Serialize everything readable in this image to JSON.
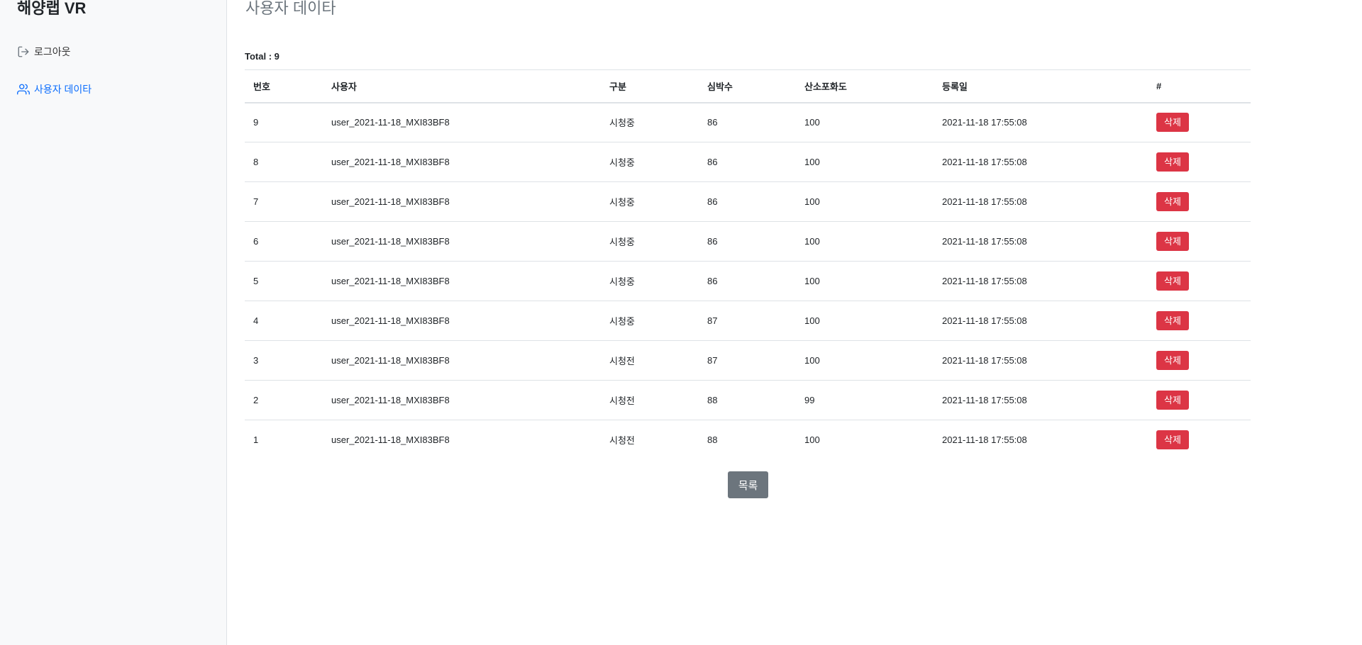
{
  "sidebar": {
    "brand": "해양랩 VR",
    "items": [
      {
        "label": "로그아웃",
        "icon": "logout-icon"
      },
      {
        "label": "사용자 데이타",
        "icon": "users-icon",
        "active": true
      }
    ]
  },
  "main": {
    "title": "사용자 데이타",
    "total": "Total : 9",
    "columns": [
      "번호",
      "사용자",
      "구분",
      "심박수",
      "산소포화도",
      "등록일",
      "#"
    ],
    "rows": [
      {
        "no": "9",
        "user": "user_2021-11-18_MXI83BF8",
        "type": "시청중",
        "hr": "86",
        "spo2": "100",
        "date": "2021-11-18 17:55:08",
        "action": "삭제"
      },
      {
        "no": "8",
        "user": "user_2021-11-18_MXI83BF8",
        "type": "시청중",
        "hr": "86",
        "spo2": "100",
        "date": "2021-11-18 17:55:08",
        "action": "삭제"
      },
      {
        "no": "7",
        "user": "user_2021-11-18_MXI83BF8",
        "type": "시청중",
        "hr": "86",
        "spo2": "100",
        "date": "2021-11-18 17:55:08",
        "action": "삭제"
      },
      {
        "no": "6",
        "user": "user_2021-11-18_MXI83BF8",
        "type": "시청중",
        "hr": "86",
        "spo2": "100",
        "date": "2021-11-18 17:55:08",
        "action": "삭제"
      },
      {
        "no": "5",
        "user": "user_2021-11-18_MXI83BF8",
        "type": "시청중",
        "hr": "86",
        "spo2": "100",
        "date": "2021-11-18 17:55:08",
        "action": "삭제"
      },
      {
        "no": "4",
        "user": "user_2021-11-18_MXI83BF8",
        "type": "시청중",
        "hr": "87",
        "spo2": "100",
        "date": "2021-11-18 17:55:08",
        "action": "삭제"
      },
      {
        "no": "3",
        "user": "user_2021-11-18_MXI83BF8",
        "type": "시청전",
        "hr": "87",
        "spo2": "100",
        "date": "2021-11-18 17:55:08",
        "action": "삭제"
      },
      {
        "no": "2",
        "user": "user_2021-11-18_MXI83BF8",
        "type": "시청전",
        "hr": "88",
        "spo2": "99",
        "date": "2021-11-18 17:55:08",
        "action": "삭제"
      },
      {
        "no": "1",
        "user": "user_2021-11-18_MXI83BF8",
        "type": "시청전",
        "hr": "88",
        "spo2": "100",
        "date": "2021-11-18 17:55:08",
        "action": "삭제"
      }
    ],
    "list_button": "목록"
  },
  "colors": {
    "sidebar_bg": "#f8f9fa",
    "active_link": "#0d6efd",
    "delete_button": "#dc3545",
    "list_button": "#6c757d"
  }
}
